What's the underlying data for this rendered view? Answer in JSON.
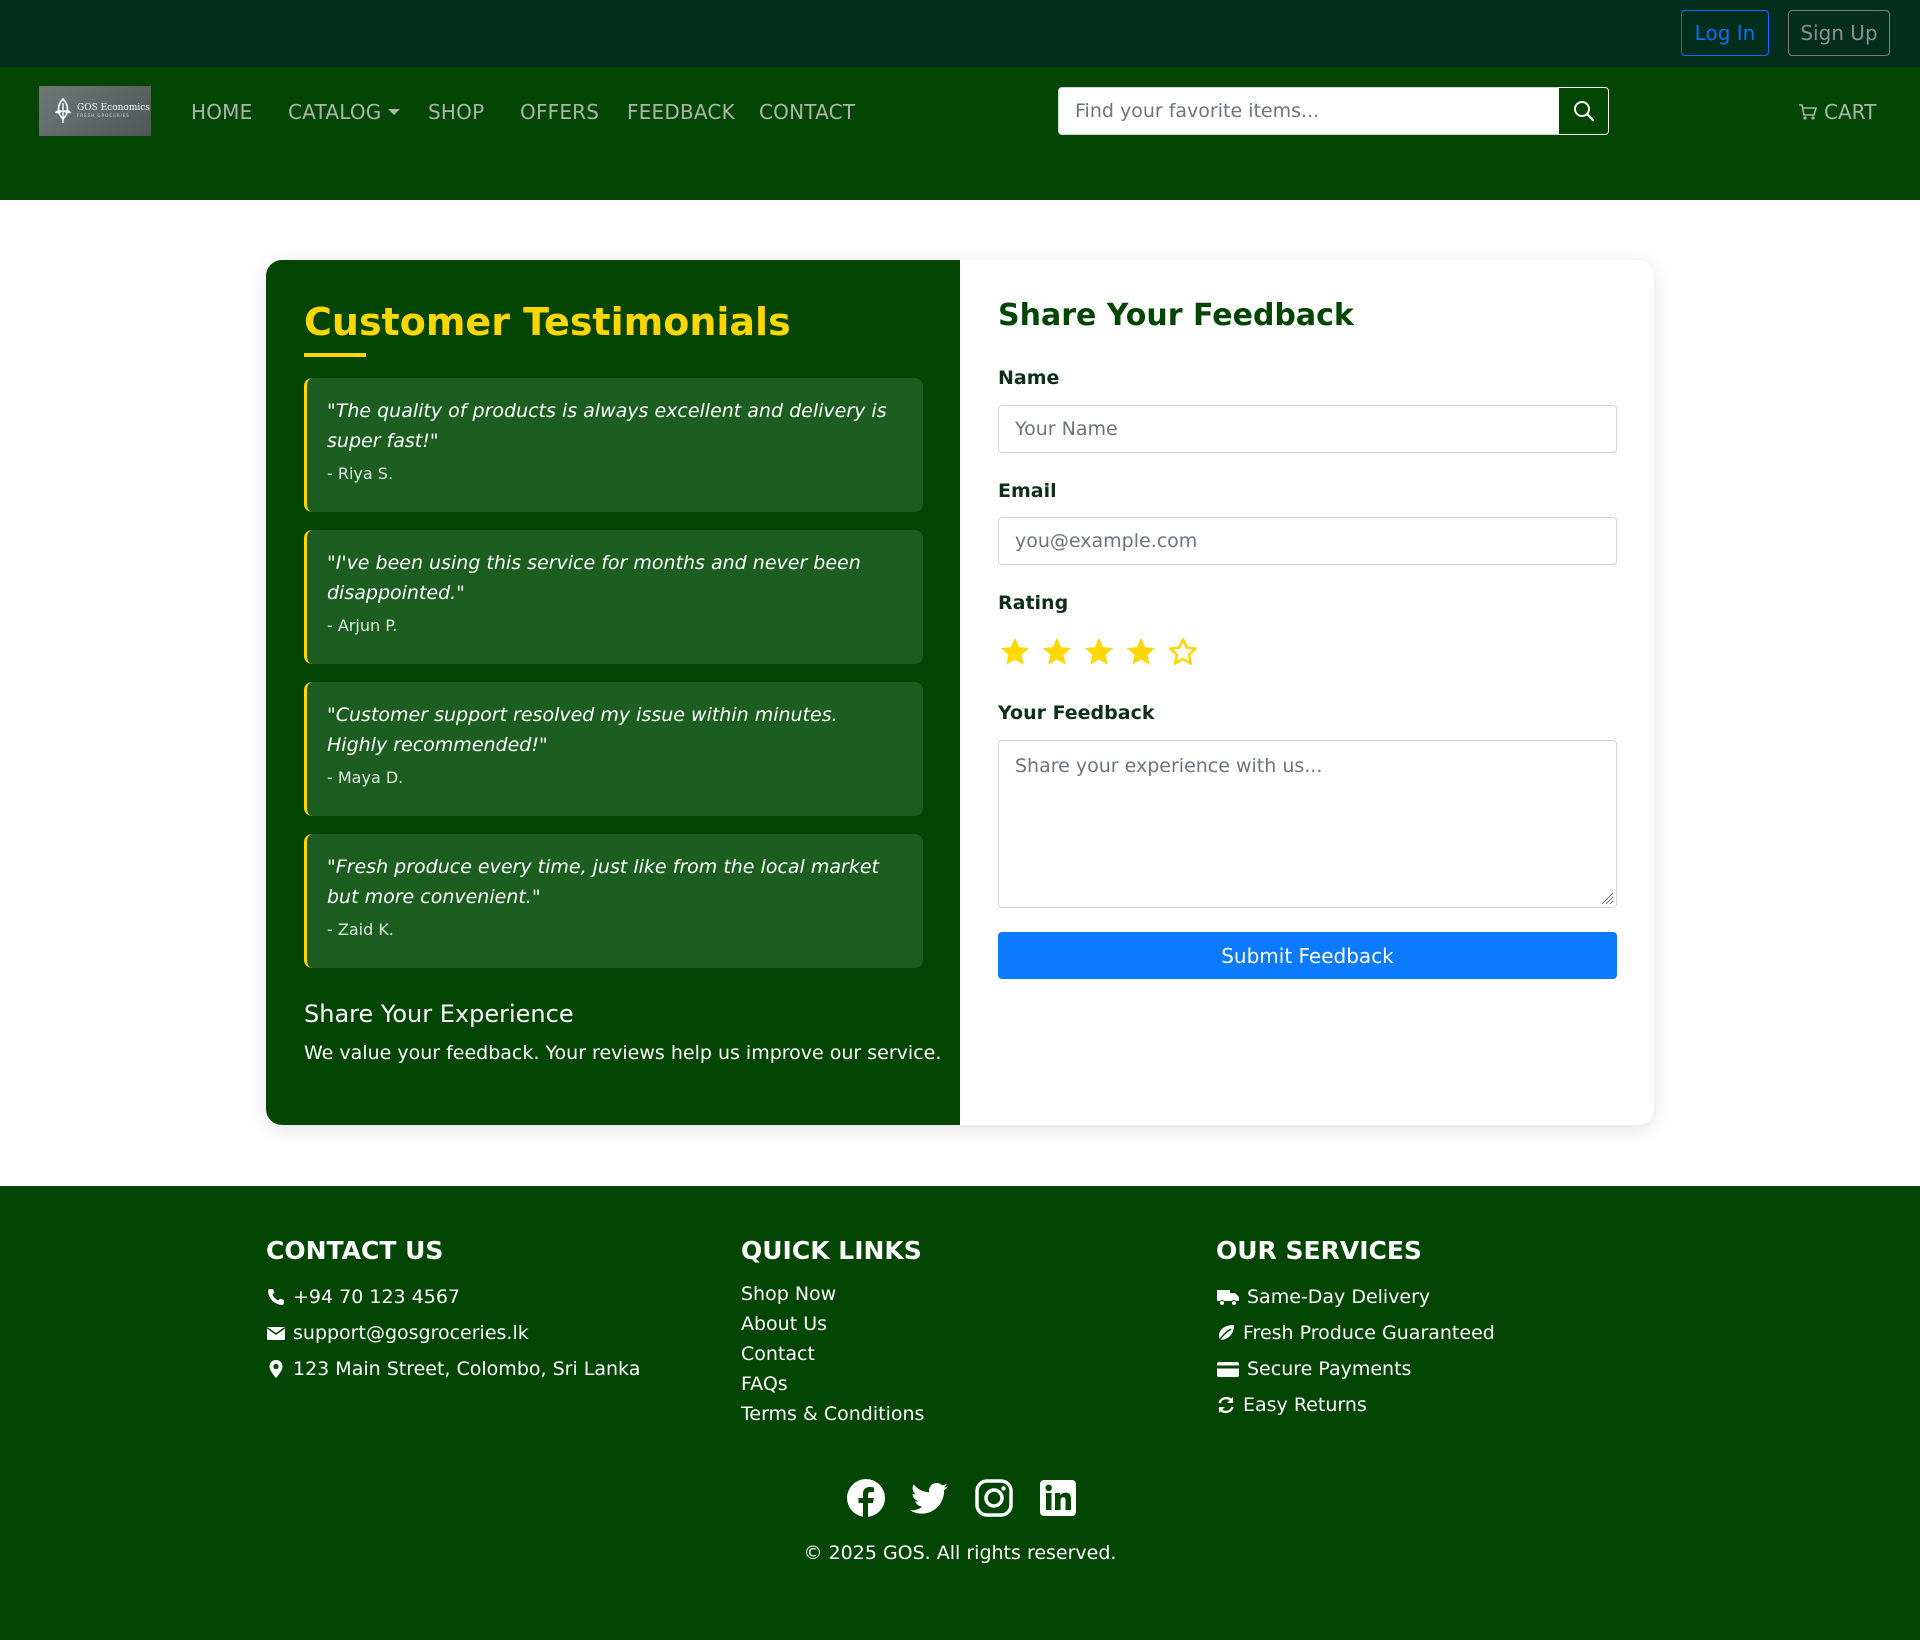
{
  "topbar": {
    "login_label": "Log In",
    "signup_label": "Sign Up"
  },
  "navbar": {
    "logo_text": "GOS Economics",
    "logo_sub": "FRESH GROCERIES",
    "links": [
      "HOME",
      "CATALOG",
      "SHOP",
      "OFFERS",
      "FEEDBACK",
      "CONTACT"
    ],
    "search_placeholder": "Find your favorite items...",
    "cart_label": "CART"
  },
  "testimonials": {
    "title": "Customer Testimonials",
    "items": [
      {
        "quote": "\"The quality of products is always excellent and delivery is super fast!\"",
        "author": "- Riya S."
      },
      {
        "quote": "\"I've been using this service for months and never been disappointed.\"",
        "author": "- Arjun P."
      },
      {
        "quote": "\"Customer support resolved my issue within minutes. Highly recommended!\"",
        "author": "- Maya D."
      },
      {
        "quote": "\"Fresh produce every time, just like from the local market but more convenient.\"",
        "author": "- Zaid K."
      }
    ],
    "experience_title": "Share Your Experience",
    "experience_text": "We value your feedback. Your reviews help us improve our service."
  },
  "feedback_form": {
    "title": "Share Your Feedback",
    "name_label": "Name",
    "name_placeholder": "Your Name",
    "email_label": "Email",
    "email_placeholder": "you@example.com",
    "rating_label": "Rating",
    "rating_value": 4,
    "rating_max": 5,
    "feedback_label": "Your Feedback",
    "feedback_placeholder": "Share your experience with us...",
    "submit_label": "Submit Feedback"
  },
  "footer": {
    "contact": {
      "heading": "CONTACT US",
      "phone": "+94 70 123 4567",
      "email": "support@gosgroceries.lk",
      "address": "123 Main Street, Colombo, Sri Lanka"
    },
    "quick_links": {
      "heading": "QUICK LINKS",
      "items": [
        "Shop Now",
        "About Us",
        "Contact",
        "FAQs",
        "Terms & Conditions"
      ]
    },
    "services": {
      "heading": "OUR SERVICES",
      "items": [
        "Same-Day Delivery",
        "Fresh Produce Guaranteed",
        "Secure Payments",
        "Easy Returns"
      ]
    },
    "socials": [
      "facebook-icon",
      "twitter-icon",
      "instagram-icon",
      "linkedin-icon"
    ],
    "copyright": "© 2025 GOS. All rights reserved."
  },
  "colors": {
    "topbar": "#032e1c",
    "brand_green": "#034503",
    "testimonial_card": "#1b5e20",
    "accent_yellow": "#ffd700",
    "primary_blue": "#0d7bff"
  }
}
